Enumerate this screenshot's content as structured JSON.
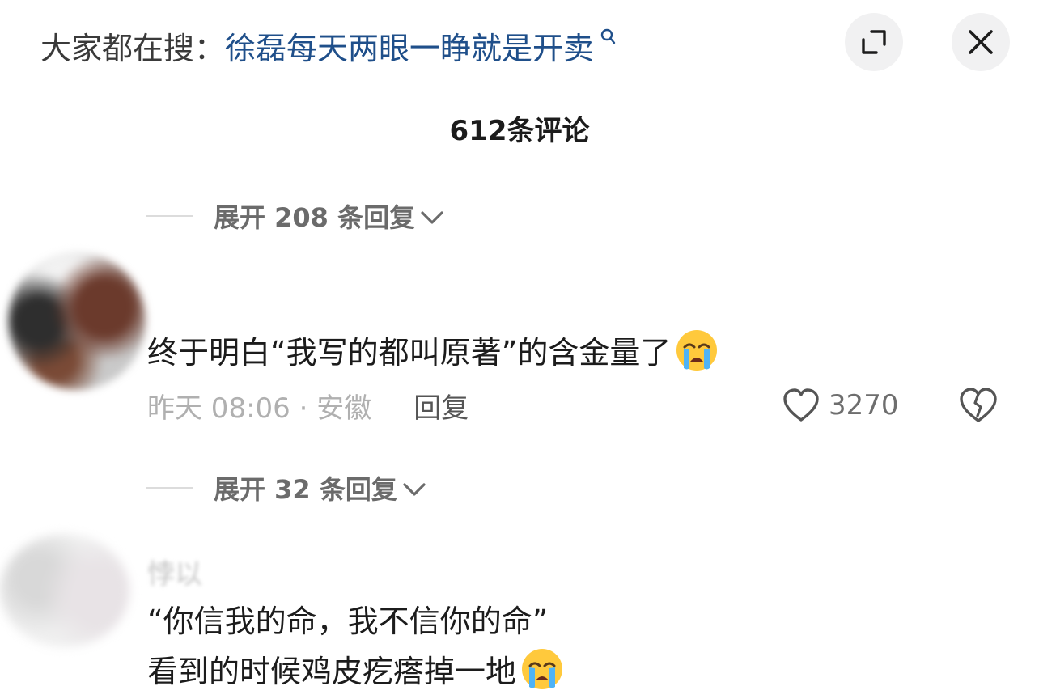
{
  "header": {
    "search_prefix": "大家都在搜：",
    "search_term": "徐磊每天两眼一睁就是开卖",
    "search_icon": "search-icon",
    "expand_icon": "expand-icon",
    "close_icon": "close-icon"
  },
  "comment_count_label": "612条评论",
  "expand_rows": [
    {
      "label": "展开 208 条回复"
    },
    {
      "label": "展开 32 条回复"
    }
  ],
  "comments": [
    {
      "username": "",
      "text": "终于明白“我写的都叫原著”的含金量了",
      "emoji": "loudly-crying-face",
      "time_location": "昨天 08:06 · 安徽",
      "reply_label": "回复",
      "like_count": "3270"
    },
    {
      "username": "悖以",
      "text_lines": [
        "“你信我的命，我不信你的命”",
        "看到的时候鸡皮疙瘩掉一地"
      ],
      "emoji": "loudly-crying-face"
    }
  ],
  "colors": {
    "search_term": "#1f4f8a",
    "text_primary": "#1c1c1c",
    "text_muted": "#b0b0b0",
    "button_bg": "#f1f1f2"
  }
}
